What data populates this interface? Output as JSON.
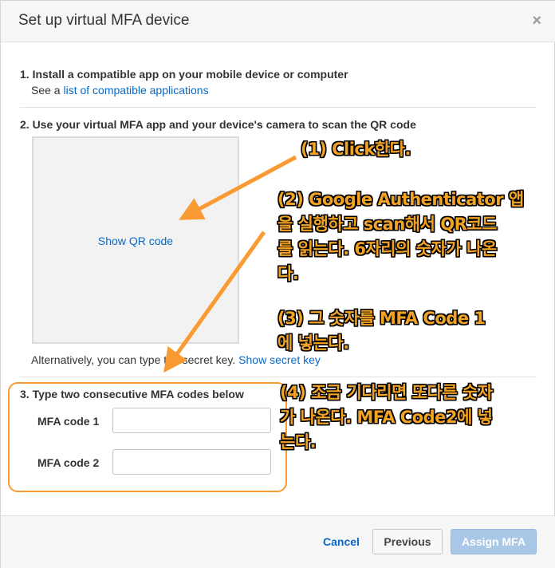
{
  "dialog": {
    "title": "Set up virtual MFA device",
    "close_glyph": "×"
  },
  "step1": {
    "title": "1. Install a compatible app on your mobile device or computer",
    "see_prefix": "See a ",
    "link": "list of compatible applications"
  },
  "step2": {
    "title": "2. Use your virtual MFA app and your device's camera to scan the QR code",
    "show_qr": "Show QR code",
    "alt_prefix": "Alternatively, you can type the secret key. ",
    "alt_link": "Show secret key"
  },
  "step3": {
    "title": "3. Type two consecutive MFA codes below",
    "code1_label": "MFA code 1",
    "code2_label": "MFA code 2",
    "code1_value": "",
    "code2_value": ""
  },
  "footer": {
    "cancel": "Cancel",
    "previous": "Previous",
    "assign": "Assign MFA"
  },
  "annotations": {
    "a1": "(1) Click한다.",
    "a2_l1": "(2) Google Authenticator 앱",
    "a2_l2": "을 실행하고 scan해서 QR코드",
    "a2_l3": "를 읽는다.  6자리의 숫자가 나온",
    "a2_l4": "다.",
    "a3_l1": "(3) 그 숫자를 MFA Code 1",
    "a3_l2": "에 넣는다.",
    "a4_l1": "(4) 조금 기다리면 또다른 숫자",
    "a4_l2": "가 나온다. MFA Code2에 넣",
    "a4_l3": "는다."
  },
  "colors": {
    "annotation": "#f3a323",
    "link": "#0a68c4",
    "primary_disabled": "#a9c7e6"
  }
}
